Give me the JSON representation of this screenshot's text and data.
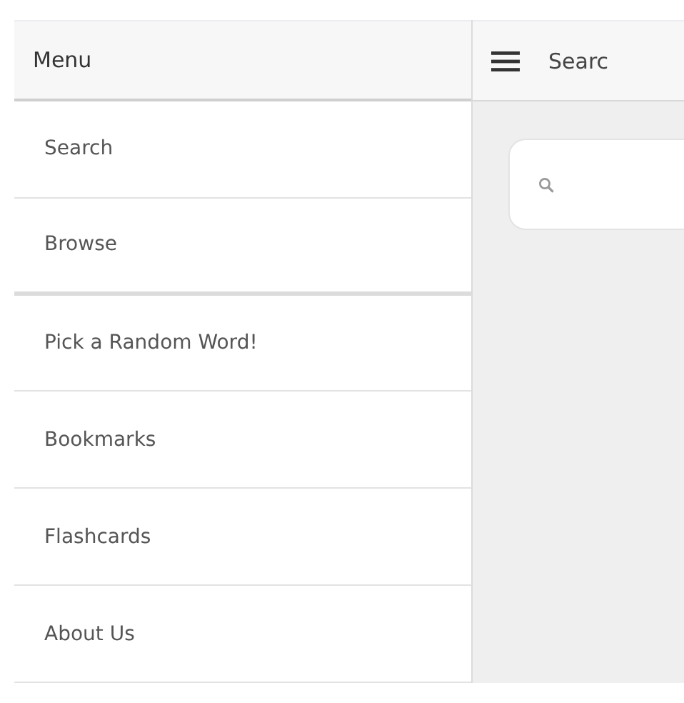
{
  "sidebar": {
    "title": "Menu",
    "items": [
      {
        "label": "Search",
        "section_end": false
      },
      {
        "label": "Browse",
        "section_end": true
      },
      {
        "label": "Pick a Random Word!",
        "section_end": false
      },
      {
        "label": "Bookmarks",
        "section_end": false
      },
      {
        "label": "Flashcards",
        "section_end": false
      },
      {
        "label": "About Us",
        "section_end": false
      }
    ]
  },
  "header": {
    "title": "Searc"
  }
}
